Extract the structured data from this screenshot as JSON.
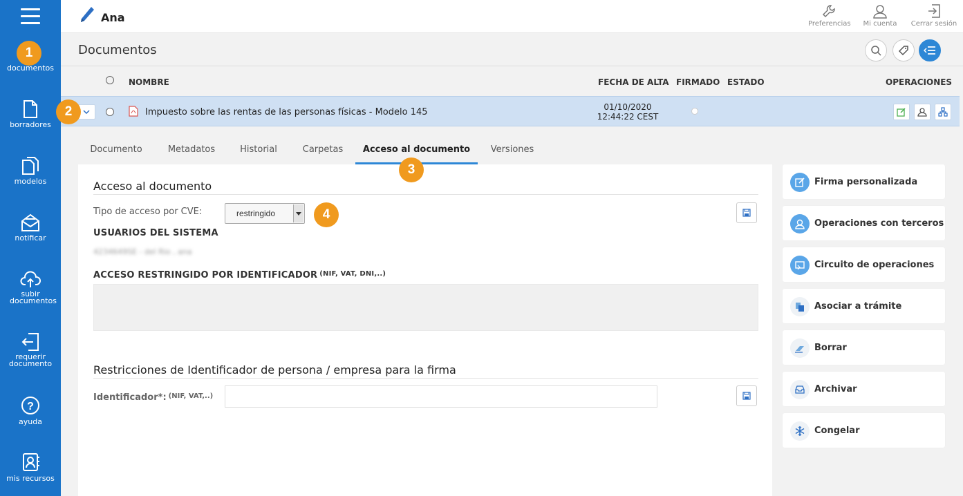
{
  "topbar": {
    "user_name": "Ana",
    "actions": [
      {
        "label": "Preferencias",
        "icon": "wrench-icon"
      },
      {
        "label": "Mi cuenta",
        "icon": "user-icon"
      },
      {
        "label": "Cerrar sesión",
        "icon": "logout-icon"
      }
    ]
  },
  "sidebar": {
    "items": [
      {
        "label": "documentos",
        "icon": "documents-icon"
      },
      {
        "label": "borradores",
        "icon": "draft-icon"
      },
      {
        "label": "modelos",
        "icon": "templates-icon"
      },
      {
        "label": "notificar",
        "icon": "notify-icon"
      },
      {
        "label": "subir documentos",
        "icon": "upload-icon"
      },
      {
        "label": "requerir documento",
        "icon": "request-icon"
      },
      {
        "label": "ayuda",
        "icon": "help-icon"
      },
      {
        "label": "mis recursos",
        "icon": "resources-icon"
      }
    ]
  },
  "badges": [
    "1",
    "2",
    "3",
    "4"
  ],
  "page": {
    "title": "Documentos"
  },
  "table": {
    "columns": {
      "name": "NOMBRE",
      "date": "FECHA DE ALTA",
      "signed": "FIRMADO",
      "status": "ESTADO",
      "operations": "OPERACIONES"
    },
    "row": {
      "name": "Impuesto sobre las rentas de las personas físicas - Modelo 145",
      "date": "01/10/2020",
      "time": "12:44:22 CEST"
    }
  },
  "tabs": [
    "Documento",
    "Metadatos",
    "Historial",
    "Carpetas",
    "Acceso al documento",
    "Versiones"
  ],
  "active_tab": "Acceso al documento",
  "access": {
    "title": "Acceso al documento",
    "cve_label": "Tipo de acceso por CVE:",
    "cve_value": "restringido",
    "system_users_heading": "USUARIOS DEL SISTEMA",
    "system_users_blurred": "4234649SE - del Rio , ana",
    "restricted_heading": "ACCESO RESTRINGIDO POR IDENTIFICADOR",
    "restricted_hint": "(NIF, VAT, DNI,..)"
  },
  "restrictions": {
    "title": "Restricciones de Identificador de persona / empresa para la firma",
    "id_label": "Identificador*:",
    "id_hint": "(NIF, VAT,..)"
  },
  "actions": [
    {
      "label": "Firma personalizada",
      "icon": "edit-icon"
    },
    {
      "label": "Operaciones con terceros",
      "icon": "user-icon"
    },
    {
      "label": "Circuito de operaciones",
      "icon": "circuit-icon"
    },
    {
      "label": "Asociar a trámite",
      "icon": "procedure-icon"
    },
    {
      "label": "Borrar",
      "icon": "eraser-icon"
    },
    {
      "label": "Archivar",
      "icon": "archive-icon"
    },
    {
      "label": "Congelar",
      "icon": "snowflake-icon"
    }
  ],
  "colors": {
    "sidebar": "#1a73c8",
    "accent": "#2d87d6",
    "badge": "#f09a1e",
    "row_selected": "#cfe0f3"
  }
}
